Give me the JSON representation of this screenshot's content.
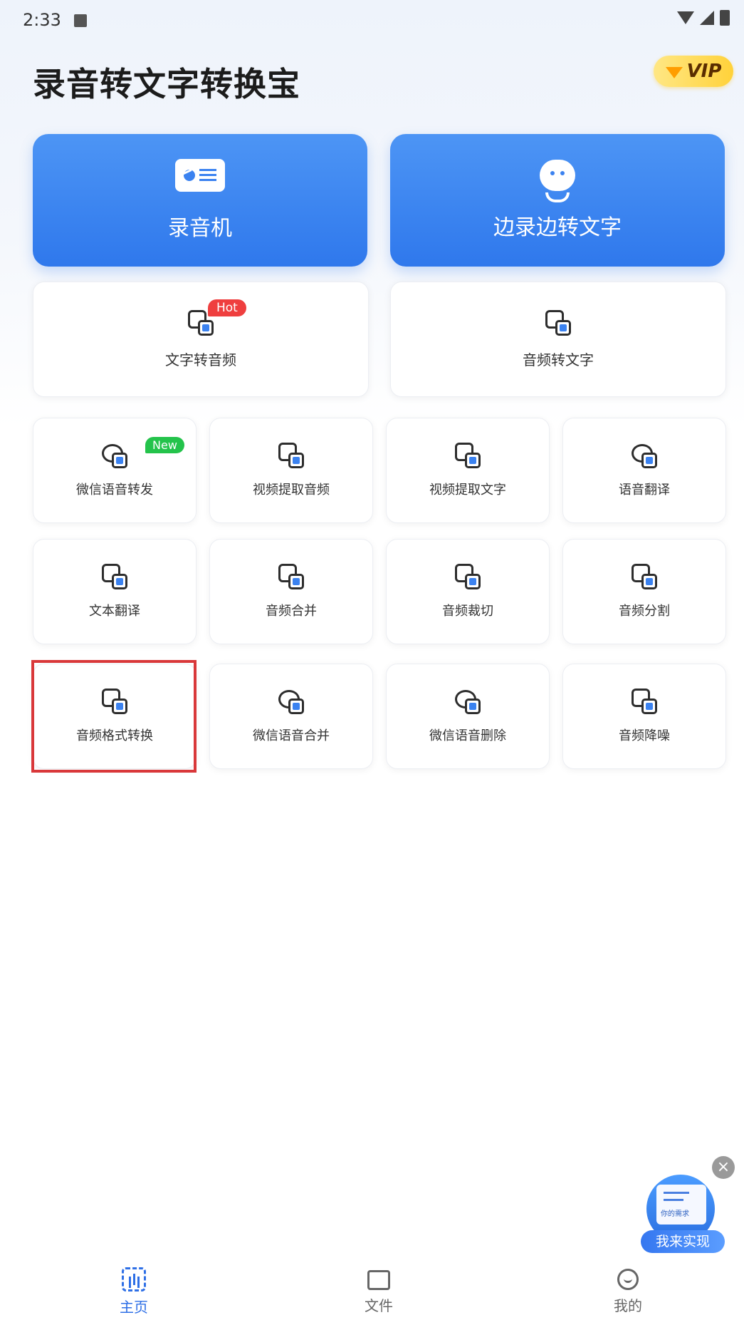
{
  "status_bar": {
    "time": "2:33"
  },
  "header": {
    "title": "录音转文字转换宝",
    "vip_label": "VIP"
  },
  "big_cards": [
    {
      "label": "录音机",
      "icon": "radio-icon"
    },
    {
      "label": "边录边转文字",
      "icon": "microphone-icon"
    }
  ],
  "mid_cards": [
    {
      "label": "文字转音频",
      "icon": "text-to-audio-icon",
      "badge": "Hot"
    },
    {
      "label": "音频转文字",
      "icon": "audio-to-text-icon"
    }
  ],
  "grid": {
    "row1": [
      {
        "label": "微信语音转发",
        "icon": "wechat-forward-icon",
        "badge": "New"
      },
      {
        "label": "视频提取音频",
        "icon": "video-extract-audio-icon"
      },
      {
        "label": "视频提取文字",
        "icon": "video-extract-text-icon"
      },
      {
        "label": "语音翻译",
        "icon": "voice-translate-icon"
      }
    ],
    "row2": [
      {
        "label": "文本翻译",
        "icon": "text-translate-icon"
      },
      {
        "label": "音频合并",
        "icon": "audio-merge-icon"
      },
      {
        "label": "音频裁切",
        "icon": "audio-cut-icon"
      },
      {
        "label": "音频分割",
        "icon": "audio-split-icon"
      }
    ],
    "row3": [
      {
        "label": "音频格式转换",
        "icon": "audio-format-convert-icon"
      },
      {
        "label": "微信语音合并",
        "icon": "wechat-merge-icon"
      },
      {
        "label": "微信语音删除",
        "icon": "wechat-delete-icon"
      },
      {
        "label": "音频降噪",
        "icon": "audio-denoise-icon"
      }
    ]
  },
  "floating_ad": {
    "top_text": "你的需求",
    "label": "我来实现"
  },
  "bottom_nav": [
    {
      "label": "主页",
      "icon": "home-icon",
      "active": true
    },
    {
      "label": "文件",
      "icon": "folder-icon"
    },
    {
      "label": "我的",
      "icon": "profile-icon"
    }
  ],
  "colors": {
    "accent": "#2e6fe6",
    "highlight_border": "#d9383a",
    "hot_badge": "#ef3f3f",
    "new_badge": "#24c34b"
  }
}
